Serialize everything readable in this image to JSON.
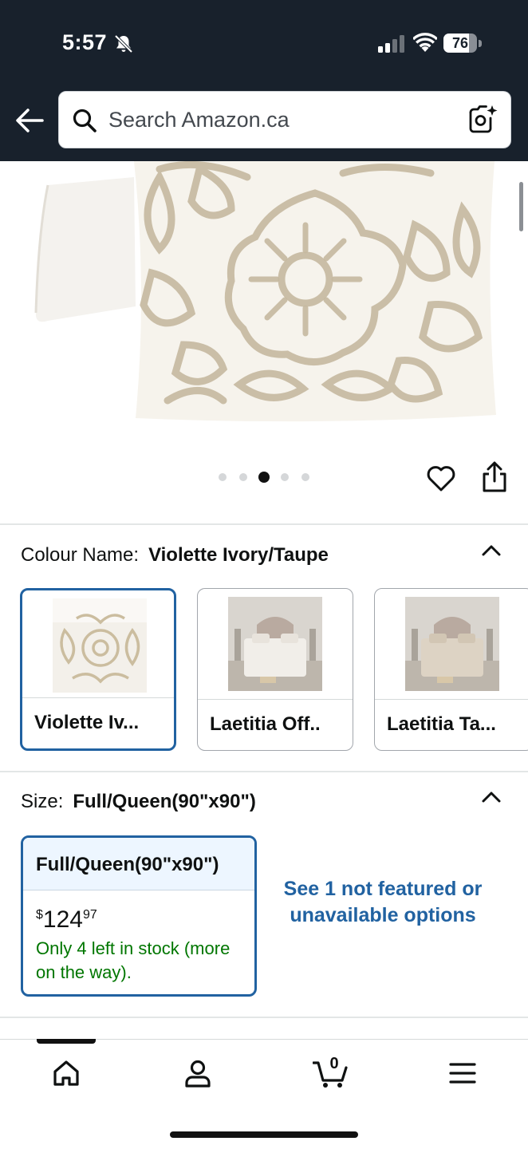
{
  "status_bar": {
    "time": "5:57",
    "battery": "76",
    "battery_level": 0.76,
    "icons": [
      "bell-slash-icon",
      "cellular-signal-icon",
      "wifi-icon",
      "battery-icon"
    ]
  },
  "header": {
    "search_placeholder": "Search Amazon.ca",
    "icons": [
      "back-arrow-icon",
      "search-icon",
      "camera-scan-icon"
    ]
  },
  "gallery": {
    "image_count": 5,
    "active_index": 2,
    "actions": [
      "heart-icon",
      "share-icon"
    ]
  },
  "colour": {
    "label": "Colour Name:",
    "selected": "Violette Ivory/Taupe",
    "options": [
      {
        "label": "Violette Iv...",
        "selected": true
      },
      {
        "label": "Laetitia Off..",
        "selected": false
      },
      {
        "label": "Laetitia Ta...",
        "selected": false
      }
    ]
  },
  "size": {
    "label": "Size:",
    "selected": "Full/Queen(90\"x90\")",
    "card": {
      "title": "Full/Queen(90\"x90\")",
      "price_currency": "$",
      "price_whole": "124",
      "price_fraction": "97",
      "stock": "Only 4 left in stock (more on the way)."
    },
    "unavailable_link": "See 1 not featured or unavailable options"
  },
  "bottom_nav": {
    "items": [
      "home-icon",
      "account-icon",
      "cart-icon",
      "menu-icon"
    ],
    "cart_count": "0"
  },
  "colors": {
    "header_bg": "#18212c",
    "selected_border": "#2162a1",
    "link": "#2162a1",
    "in_stock": "#007600"
  }
}
